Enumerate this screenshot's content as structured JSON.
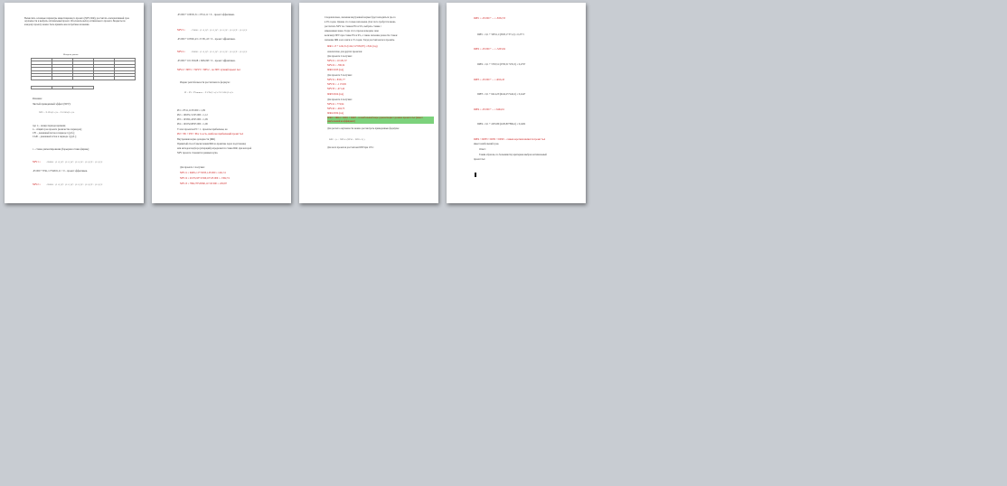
{
  "page1": {
    "intro": "Вычислить основные параметры инвестиционного проекта (NPV, IRR), рассчитать альтернативный срок окупаемости и выбрать оптимальный проект. Обосновать выбор оптимального проекта. Бюджеты по каждому проекту можно быть приняты как потребные вложения.",
    "table_title": "Исходные данные",
    "solution": "Решение:",
    "npv_heading": "Чистый приведенный эффект (NPV):",
    "where": "где: n – номер периода времени;",
    "l1": "n – общий срок проекта (количество периодов);",
    "l2": "CFt – денежный поток в периоде t (руб.);",
    "l3": "CAPt – денежный отток в периоде t (руб.);",
    "l4": "r – ставка дисконтирования (барьерная ставка фирмы);",
    "npv1": "NPV1 =",
    "res1": "-95 000 + 8741,11+94631,11 > 0 – проект эффективен.",
    "npv2": "NPV2 ="
  },
  "page2": {
    "l1": "-95 000 + 106331,51 = 8741,11 > 0 – проект эффективен.",
    "npv3": "NPV3 =",
    "l2": "-95 000 + 103301,43 = 8 331,43 > 0 – проект эффективен.",
    "npv4": "NPV4 =",
    "l3": "-95 000 + 101 032,68 = 6032,68 > 0 – проект эффективен.",
    "cmp": "NPV4 > NPV1 > NPV3 > NPV2 – по NPV лучший проект №4",
    "pi_heading": "Индекс рентабельности рассчитаем по формуле:",
    "pi1": "PI1 = 8741,11/95 000 = 1,09",
    "pi2": "PI2 = 106331,51/95 000 = 1,12",
    "pi3": "PI3 = 103301,43/95 000 = 1,09",
    "pi4": "PI4 = 101032,68/95 000 = 1,06",
    "pi_note": "У всех проектов PI > 1 - проекты прибыльны, но",
    "pi_cmp": "PI2 > PI1 > PI3 > PI4, то есть, наиболее прибыльный проект №2",
    "irr_heading": "Внутренняя норма доходности (IRR)",
    "irr_text1": "Принятый способ вычисления IRR на практике через подстановку",
    "irr_text2": "или методом подбора (итераций) определяется ставка IRR, при которой",
    "irr_text3": "NPV проекта становится равным нулю.",
    "irr_p1": "Для проекта 1 получим:",
    "n1": "NPV11 = 94631,11+72033,1-95 000 = 1241,51",
    "n2": "NPV12 = 20155,93+21560,107-95 000 = -7262,74",
    "n3": "NPV13 = 7862,78+26560,117-95 000 = -650,87"
  },
  "page3": {
    "p1": "Следовательно, значение внутренней нормы будет находиться где-то",
    "p2": "в 9% годов. Однако это только начальная. Для этого требуется вновь",
    "p3": "рассчитать NPV по ставкам 8% и 9%, выбрать ставки с",
    "p4": "изменением знака. Тогда этот отрезок находим, зная",
    "p5": "величину NPV при ставке 8% и 9%, а также значение разности ставок:",
    "p6": "значение IRR и его шаги в 1% годов. Тогда рассчитаем все проекты.",
    "irr1": "IRR1 = 8 + 1241,51/(1241,51+650,87) = 8,64 (год)",
    "calc2": "Аналогично для других проектов:",
    "p2h": "Для проекта 2 получим:",
    "a1": "NPV21 = 10 181,37",
    "a2": "NPV22 = -706,32",
    "irr2": "IRR2=9,93 (год)",
    "p3h": "Для проекта 3 получим:",
    "b1": "NPV31 = 8331,77",
    "b2": "NPV32 = -1 153,81",
    "b3": "NPV33 = -471,42",
    "irr3": "IRR3=8,64 (год)",
    "p4h": "Для проекта 4 получим:",
    "c1": "NPV41 = 774,94",
    "c2": "NPV42 = -404,75",
    "irr4": "IRR4=8,84 (год)",
    "cmp": "IRR2 > IRR4 > IRR1 > IRR3 – в наибольшей мере удовлетворяет уровню проекта №2 (имеет наибольший коэффициент)",
    "dpp_heading": "Для расчета окупаемости можно рассмотреть приведенные формулы:",
    "dpp_all": "Для всех проектов рассчитаем DPP при 10%:"
  },
  "page4": {
    "d1": "DPP1 = -95 000 + ... = -8332,33",
    "d2": "DPP2 = -95 000 + ... = -5203,94",
    "d3": "DPP3 = -95 000 + ... = 4016,43",
    "d4": "DPP4 = -95 000 + ... = 6404,61",
    "r1": "DPP1 = 0,1 + 56351,1/(5635,1+371,2) = 0,2771",
    "r2": "DPP2 = 0,1 + 5793,51/(5793,51+255,3) = 0,2797",
    "r3": "DPP3 = 0,1 + 6414,25/(6414,25+442,2) = 0,2447",
    "r4": "DPP4 = 0,1 + 2435,80/(2435,80+884,2) = 0,2402",
    "cmp": "DPP4 < DPP3 < DPP1 < DPP2 – самым коротким является проект №4",
    "cmp2": "имеет наибольший срок.",
    "concl": "Ответ:",
    "concl2": "Таким образом, по большинству критериев выбран оптимальный",
    "concl3": "проект №2."
  }
}
